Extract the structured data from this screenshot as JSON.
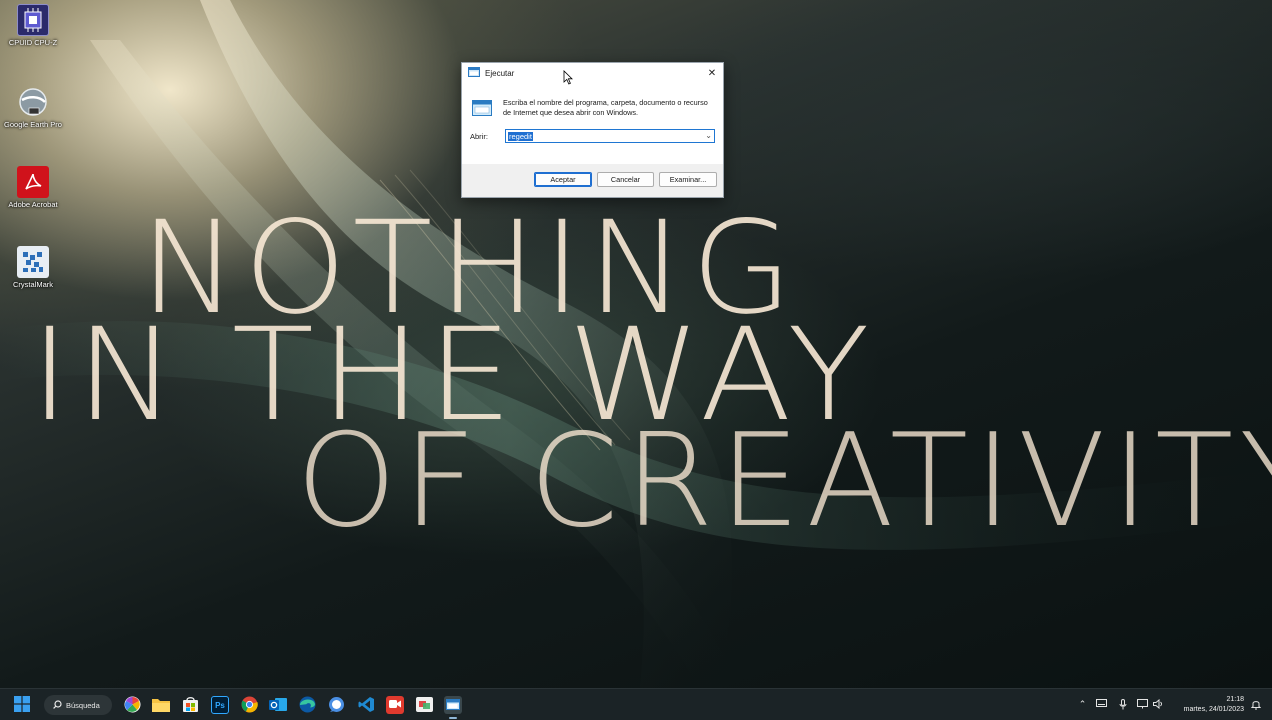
{
  "wallpaper": {
    "line1": "NOTHING",
    "line2": "IN THE WAY",
    "line3": "OF CREATIVITY"
  },
  "desktop_icons": [
    {
      "label": "CPUID CPU-Z",
      "icon": "cpu-z-icon"
    },
    {
      "label": "Google Earth Pro",
      "icon": "google-earth-icon"
    },
    {
      "label": "Adobe Acrobat",
      "icon": "acrobat-icon"
    },
    {
      "label": "CrystalMark",
      "icon": "crystalmark-icon"
    }
  ],
  "run_dialog": {
    "title": "Ejecutar",
    "description": "Escriba el nombre del programa, carpeta, documento o recurso de Internet que desea abrir con Windows.",
    "open_label": "Abrir:",
    "open_value": "regedit",
    "ok_label": "Aceptar",
    "cancel_label": "Cancelar",
    "browse_label": "Examinar..."
  },
  "taskbar": {
    "search_label": "Búsqueda",
    "apps": [
      {
        "name": "start",
        "icon": "windows-start-icon"
      },
      {
        "name": "widgets",
        "icon": "pinwheel-icon"
      },
      {
        "name": "file-explorer",
        "icon": "folder-icon"
      },
      {
        "name": "store",
        "icon": "store-icon"
      },
      {
        "name": "photoshop",
        "icon": "photoshop-icon",
        "text": "Ps"
      },
      {
        "name": "chrome",
        "icon": "chrome-icon"
      },
      {
        "name": "outlook",
        "icon": "outlook-icon"
      },
      {
        "name": "edge",
        "icon": "edge-icon"
      },
      {
        "name": "signal",
        "icon": "chat-icon"
      },
      {
        "name": "vscode",
        "icon": "vscode-icon"
      },
      {
        "name": "screen-recorder",
        "icon": "recorder-icon"
      },
      {
        "name": "snipping",
        "icon": "snipping-icon"
      },
      {
        "name": "run",
        "icon": "run-icon"
      }
    ],
    "clock_time": "21:18",
    "clock_date": "martes, 24/01/2023"
  },
  "colors": {
    "accent": "#1f6fd1",
    "taskbar": "#1b2326"
  }
}
